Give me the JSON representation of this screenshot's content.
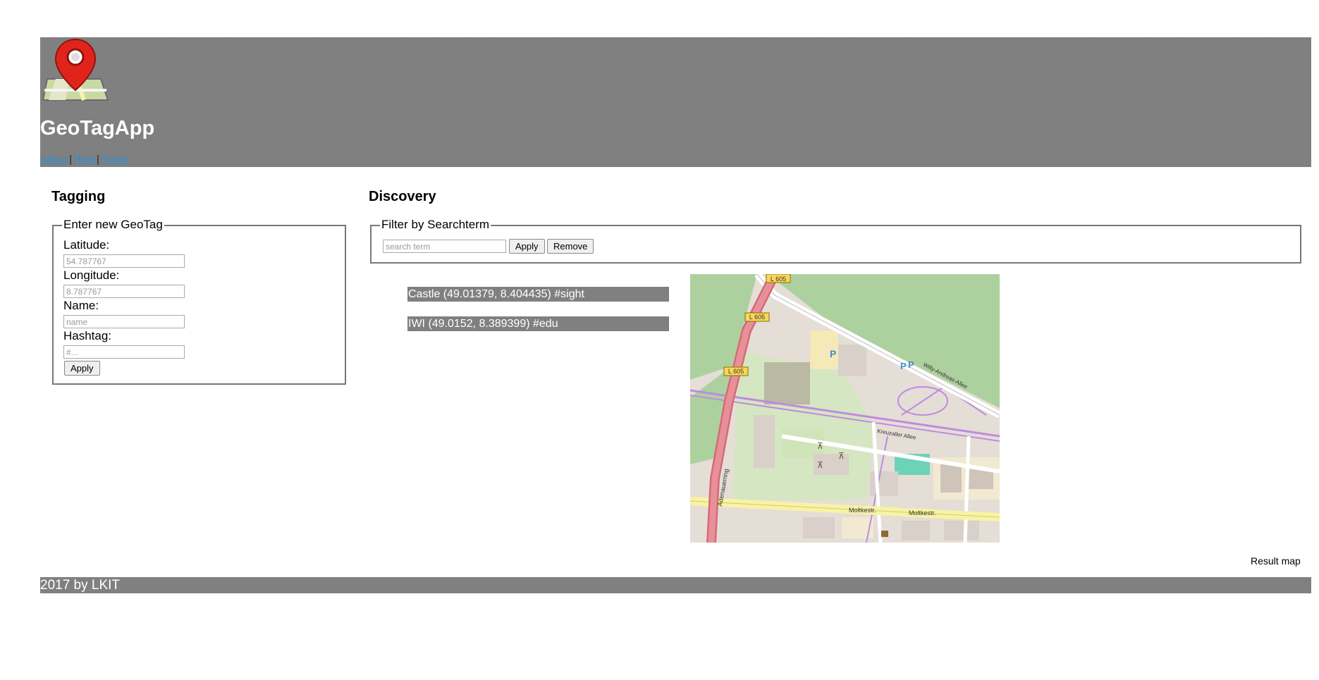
{
  "header": {
    "title": "GeoTagApp",
    "nav": [
      "About",
      "Help",
      "Home"
    ]
  },
  "tagging": {
    "title": "Tagging",
    "legend": "Enter new GeoTag",
    "latitude_label": "Latitude:",
    "latitude_placeholder": "54.787767",
    "longitude_label": "Longitude:",
    "longitude_placeholder": "8.787767",
    "name_label": "Name:",
    "name_placeholder": "name",
    "hashtag_label": "Hashtag:",
    "hashtag_placeholder": "#...",
    "apply_label": "Apply"
  },
  "discovery": {
    "title": "Discovery",
    "legend": "Filter by Searchterm",
    "search_placeholder": "search term",
    "apply_label": "Apply",
    "remove_label": "Remove",
    "results": [
      "Castle (49.01379, 8.404435) #sight",
      "IWI (49.0152, 8.389399) #edu"
    ],
    "map_caption": "Result map",
    "map_labels": {
      "road_l605": "L 605",
      "adenauerring": "Adenauerring",
      "moltkestr": "Moltkestr.",
      "willy_andreas": "Willy-Andreas-Allee",
      "kreuzaller": "Kreuzaller Allee",
      "parking": "P"
    }
  },
  "footer": {
    "text": "2017 by LKIT"
  },
  "colors": {
    "bar_gray": "#808080",
    "link_blue": "#2d8fd6",
    "map_green": "#add19e",
    "map_road_red": "#e8909a",
    "map_road_yellow": "#f7f3a5"
  }
}
